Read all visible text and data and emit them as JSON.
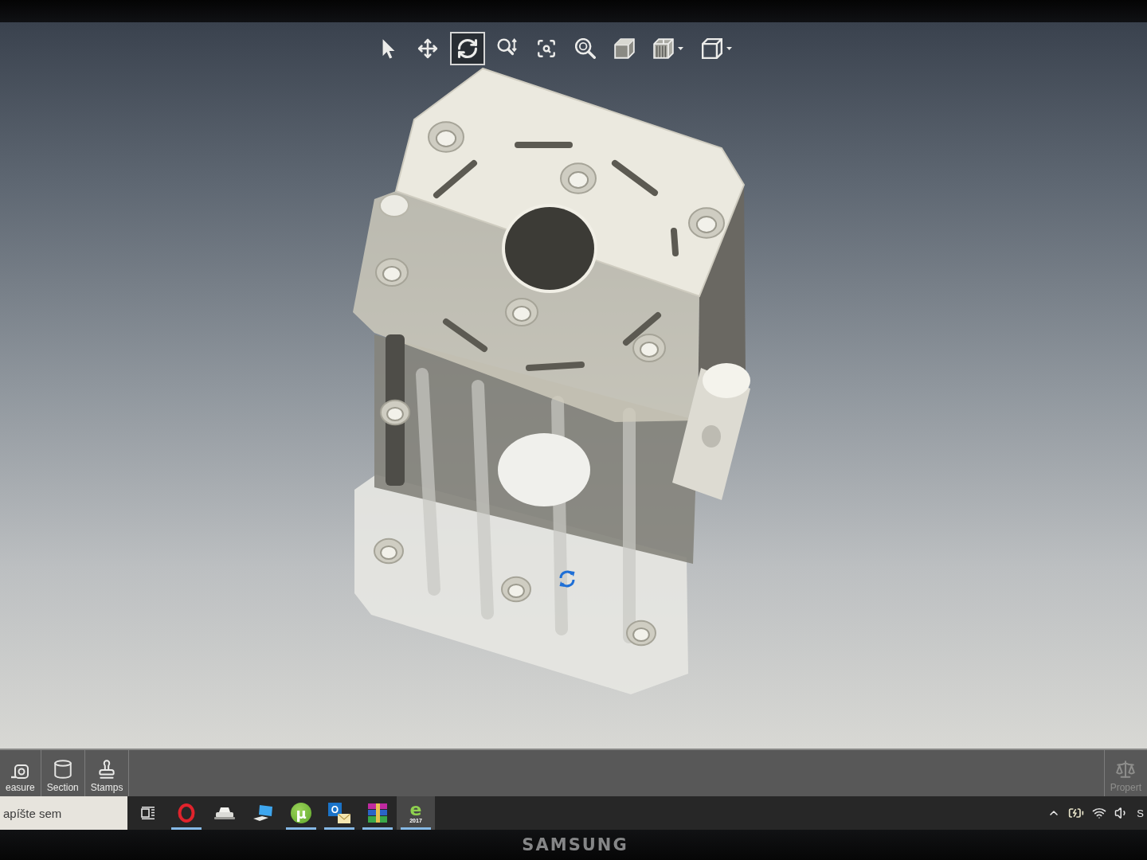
{
  "toolbar": {
    "tools": [
      {
        "kind": "select",
        "selected": false,
        "dropdown": false
      },
      {
        "kind": "pan",
        "selected": false,
        "dropdown": false
      },
      {
        "kind": "rotate",
        "selected": true,
        "dropdown": false
      },
      {
        "kind": "zoom",
        "selected": false,
        "dropdown": false
      },
      {
        "kind": "zoom-area",
        "selected": false,
        "dropdown": false
      },
      {
        "kind": "zoom-fit",
        "selected": false,
        "dropdown": false
      },
      {
        "kind": "shaded",
        "selected": false,
        "dropdown": false
      },
      {
        "kind": "section",
        "selected": false,
        "dropdown": true
      },
      {
        "kind": "orientation",
        "selected": false,
        "dropdown": true
      }
    ]
  },
  "ribbon": {
    "tools": [
      {
        "kind": "measure",
        "label": "easure",
        "disabled": false
      },
      {
        "kind": "section",
        "label": "Section",
        "disabled": false
      },
      {
        "kind": "stamps",
        "label": "Stamps",
        "disabled": false
      }
    ],
    "side_tools": [
      {
        "kind": "properties",
        "label": "Propert",
        "disabled": true
      }
    ]
  },
  "taskbar": {
    "search": {
      "placeholder": "apíšte sem"
    },
    "apps": [
      {
        "kind": "task-view",
        "running": false,
        "selected": false
      },
      {
        "kind": "browser",
        "running": true,
        "selected": false
      },
      {
        "kind": "printer",
        "running": false,
        "selected": false
      },
      {
        "kind": "computer",
        "running": false,
        "selected": false
      },
      {
        "kind": "torrent",
        "glyph": "µ",
        "running": true,
        "selected": false
      },
      {
        "kind": "mail",
        "glyph": "O",
        "running": true,
        "selected": false
      },
      {
        "kind": "archive",
        "running": true,
        "selected": false
      },
      {
        "kind": "cad-viewer",
        "glyph": "e",
        "version": "2017",
        "running": true,
        "selected": true
      }
    ],
    "tray": {
      "icons": [
        {
          "kind": "show-hidden"
        },
        {
          "kind": "power"
        },
        {
          "kind": "wifi"
        },
        {
          "kind": "volume"
        }
      ],
      "language": "S"
    }
  },
  "monitor": {
    "brand": "SAMSUNG"
  }
}
